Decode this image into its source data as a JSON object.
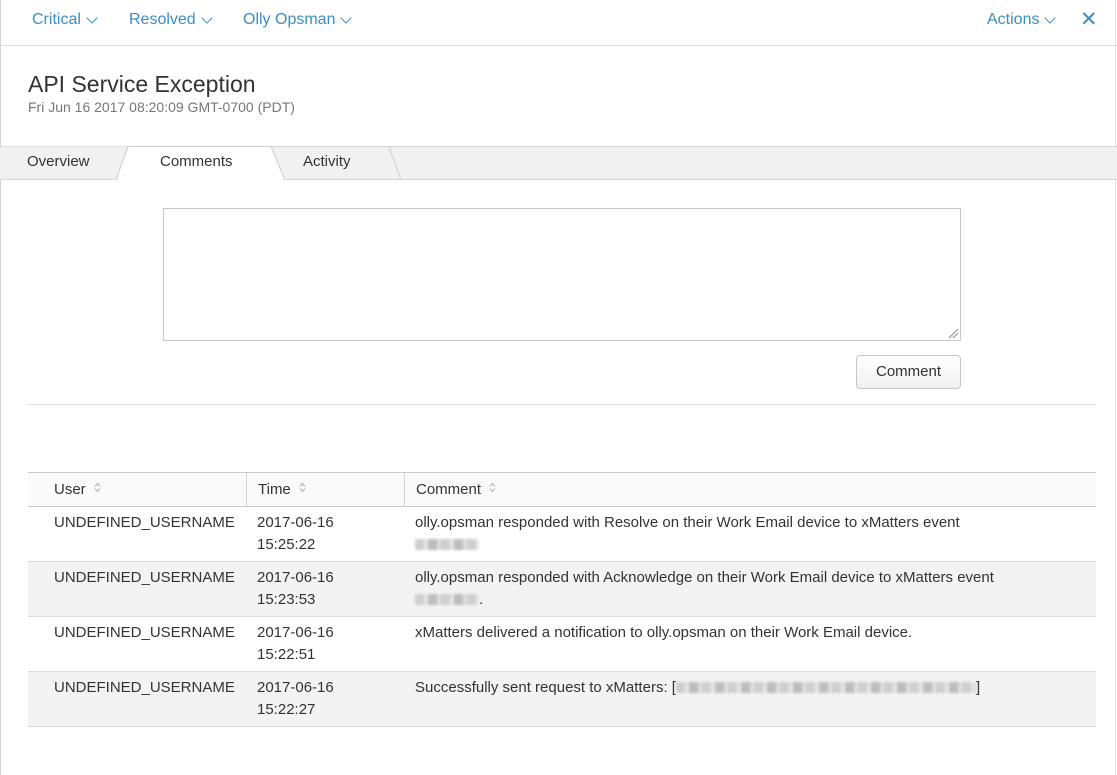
{
  "topbar": {
    "severity": "Critical",
    "status": "Resolved",
    "owner": "Olly Opsman",
    "actions": "Actions",
    "close_glyph": "✕"
  },
  "header": {
    "title": "API Service Exception",
    "timestamp": "Fri Jun 16 2017 08:20:09 GMT-0700 (PDT)"
  },
  "tabs": [
    {
      "label": "Overview",
      "active": false
    },
    {
      "label": "Comments",
      "active": true
    },
    {
      "label": "Activity",
      "active": false
    }
  ],
  "comment_form": {
    "textarea_value": "",
    "button_label": "Comment"
  },
  "table": {
    "columns": [
      "User",
      "Time",
      "Comment"
    ],
    "rows": [
      {
        "user": "UNDEFINED_USERNAME",
        "date": "2017-06-16",
        "time": "15:25:22",
        "comment": "olly.opsman responded with Resolve on their Work Email device to xMatters event"
      },
      {
        "user": "UNDEFINED_USERNAME",
        "date": "2017-06-16",
        "time": "15:23:53",
        "comment": "olly.opsman responded with Acknowledge on their Work Email device to xMatters event",
        "trailing": "."
      },
      {
        "user": "UNDEFINED_USERNAME",
        "date": "2017-06-16",
        "time": "15:22:51",
        "comment": "xMatters delivered a notification to olly.opsman on their Work Email device."
      },
      {
        "user": "UNDEFINED_USERNAME",
        "date": "2017-06-16",
        "time": "15:22:27",
        "comment": "Successfully sent request to xMatters: [",
        "trailing": "]"
      }
    ]
  },
  "colors": {
    "link_blue": "#3a8ec3",
    "text": "#333333",
    "muted": "#777777",
    "tabbar_bg": "#f1f1f1",
    "row_stripe": "#f3f3f3"
  },
  "icons": [
    "chevron-down-icon",
    "close-icon",
    "sort-icon",
    "resize-grip-icon"
  ]
}
